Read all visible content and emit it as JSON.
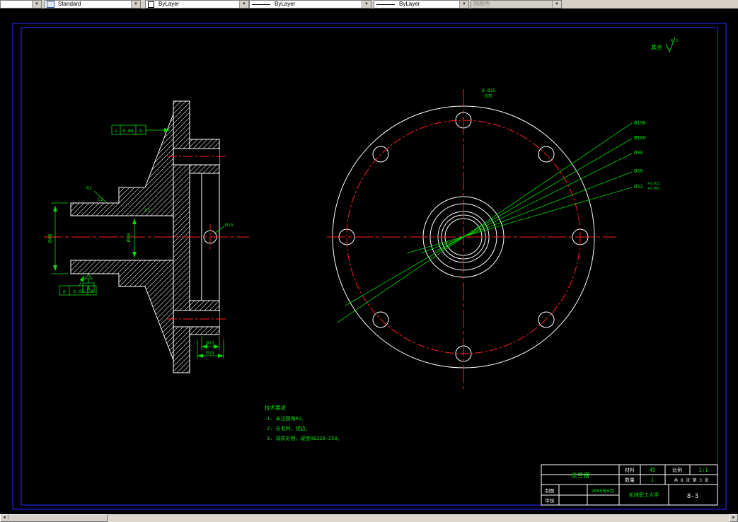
{
  "toolbar": {
    "combo1": "",
    "style": "Standard",
    "color": "ByLayer",
    "linetype": "ByLayer",
    "lineweight": "ByLayer",
    "plotstyle": "随颜色"
  },
  "icons": {
    "dropdown": "▼",
    "scroll_left": "◄",
    "scroll_right": "►"
  },
  "drawing": {
    "callout_line1": "8-Ø15",
    "callout_line2": "均布",
    "roughness_prefix": "其余",
    "roughness_value": "6.3",
    "dims": {
      "d190": "Ø190",
      "d160": "Ø160",
      "d90": "Ø90",
      "d66": "Ø66",
      "d52": "Ø52",
      "d52_up": "+0.021",
      "d52_lo": "+0.002",
      "d40": "Ø40",
      "d60": "Ø60",
      "r2": "R2",
      "c2a": "C2",
      "c2b": "C2",
      "d15_hole": "Ø15",
      "d15_boss": "Ø15",
      "d19_boss": "Ø19",
      "perp_sym": "⊥",
      "perp_val": "0.04",
      "perp_ref": "A",
      "conc_sym": "◎",
      "conc_val": "0.02",
      "conc_ref": "A",
      "datum": "A"
    },
    "notes": {
      "title": "技术要求",
      "line1": "1. 未注圆角R2。",
      "line2": "2. 去毛刺、锐边。",
      "line3": "3. 调质处理，硬度HB220~250。"
    }
  },
  "titleblock": {
    "part_name": "法兰盘",
    "material_label": "材料",
    "material": "45",
    "scale_label": "比例",
    "scale": "1:1",
    "qty_label": "数量",
    "qty": "1",
    "sheets": "共 8 张 第 3 张",
    "draft_label": "制图",
    "check_label": "审核",
    "date": "2009年6月",
    "org": "机械职工大学",
    "dwg_no": "8-3"
  }
}
